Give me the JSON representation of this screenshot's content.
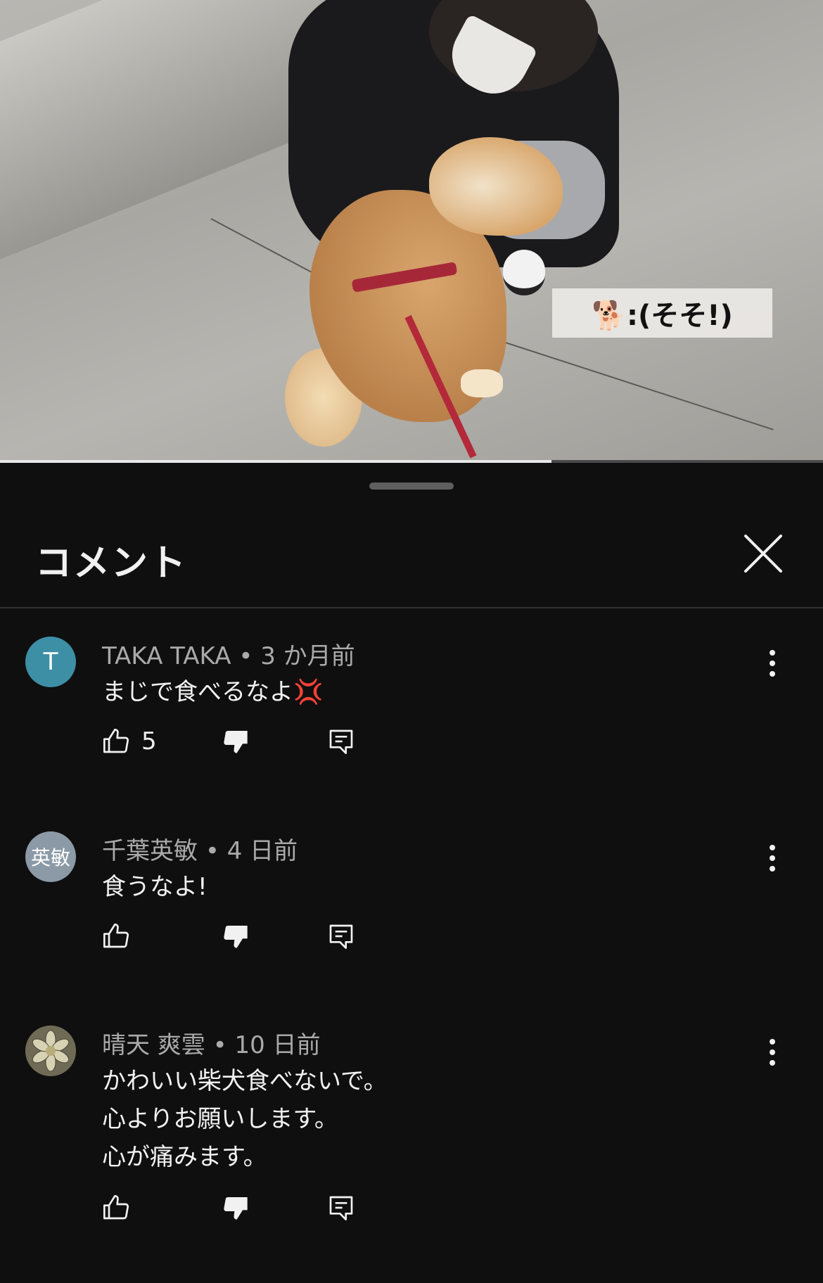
{
  "video": {
    "caption": "🐕:(そそ!)",
    "progress": 0.67
  },
  "sheet": {
    "title": "コメント"
  },
  "comments": [
    {
      "author": "TAKA TAKA",
      "time": "3 か月前",
      "avatar_text": "T",
      "avatar_color": "#3d8fa6",
      "lines": [
        "まじで食べるなよ💢"
      ],
      "likes": "5"
    },
    {
      "author": "千葉英敏",
      "time": "4 日前",
      "avatar_text": "英敏",
      "avatar_color": "#8b9aa6",
      "lines": [
        "食うなよ!"
      ],
      "likes": ""
    },
    {
      "author": "晴天 爽雲",
      "time": "10 日前",
      "avatar_text": "",
      "avatar_color": "#7e7862",
      "lines": [
        "かわいい柴犬食べないで。",
        "心よりお願いします。",
        "心が痛みます。"
      ],
      "likes": ""
    }
  ],
  "icons": {
    "close": "close-icon",
    "more": "more-vert-icon",
    "like": "thumb-up-icon",
    "dislike": "thumb-down-icon",
    "reply": "reply-icon"
  }
}
